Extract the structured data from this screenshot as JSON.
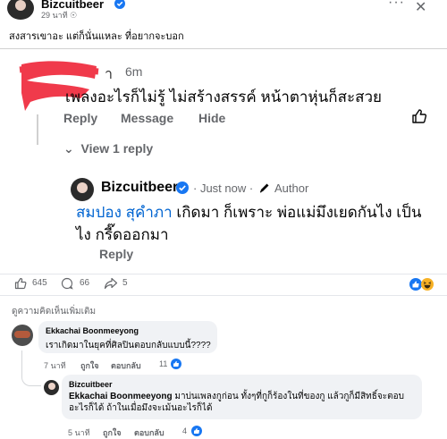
{
  "post": {
    "author": "Bizcuitbeer",
    "time": "29 นาที",
    "text": "สงสารเขาอะ แต่ก็นั่นแหละ ที่อยากจะบอก"
  },
  "screenshot": {
    "comment": {
      "name_partial": "า",
      "time": "6m",
      "text": "เพลงอะไรก็ไม่รู้ ไม่สร้างสรรค์  หน้าตาหุ่นก็สะสวย",
      "actions": {
        "reply": "Reply",
        "message": "Message",
        "hide": "Hide"
      },
      "view_replies": "View 1 reply"
    },
    "reply": {
      "name": "Bizcuitbeer",
      "time": "· Just now ·",
      "author_badge": "Author",
      "mention": "สมปอง สุคำภา",
      "text": " เกิดมา ก็เพราะ พ่อแม่มึงเยดกันไง เป็นไง กรี๊ดออกมา",
      "reply_label": "Reply"
    }
  },
  "stats": {
    "likes": "645",
    "comments": "66",
    "shares": "5"
  },
  "more_comments": {
    "title": "ดูความคิดเห็นเพิ่มเติม",
    "items": [
      {
        "name": "Ekkachai Boonmeeyong",
        "text": "เราเกิดมาในยุคที่ศิลปินตอบกลับแบบนี้????",
        "time": "7 นาที",
        "like": "ถูกใจ",
        "reply": "ตอบกลับ",
        "reactions": "11"
      },
      {
        "name": "Bizcuitbeer",
        "mention": "Ekkachai Boonmeeyong",
        "text": " มาบ่นเพลงกูก่อน ทั้งๆที่กูก็ร้องในที่ของกู แล้วกูก็มีสิทธิ์จะตอบอะไรก็ได้ ถ้าในเมื่อมึงจะเม้นอะไรก็ได้",
        "time": "5 นาที",
        "like": "ถูกใจ",
        "reply": "ตอบกลับ",
        "reactions": "4"
      }
    ]
  },
  "colors": {
    "link": "#0064d1",
    "muted": "#65676b",
    "bubble": "#f0f2f5",
    "like_blue": "#1877f2",
    "redaction": "#f03a4b"
  }
}
